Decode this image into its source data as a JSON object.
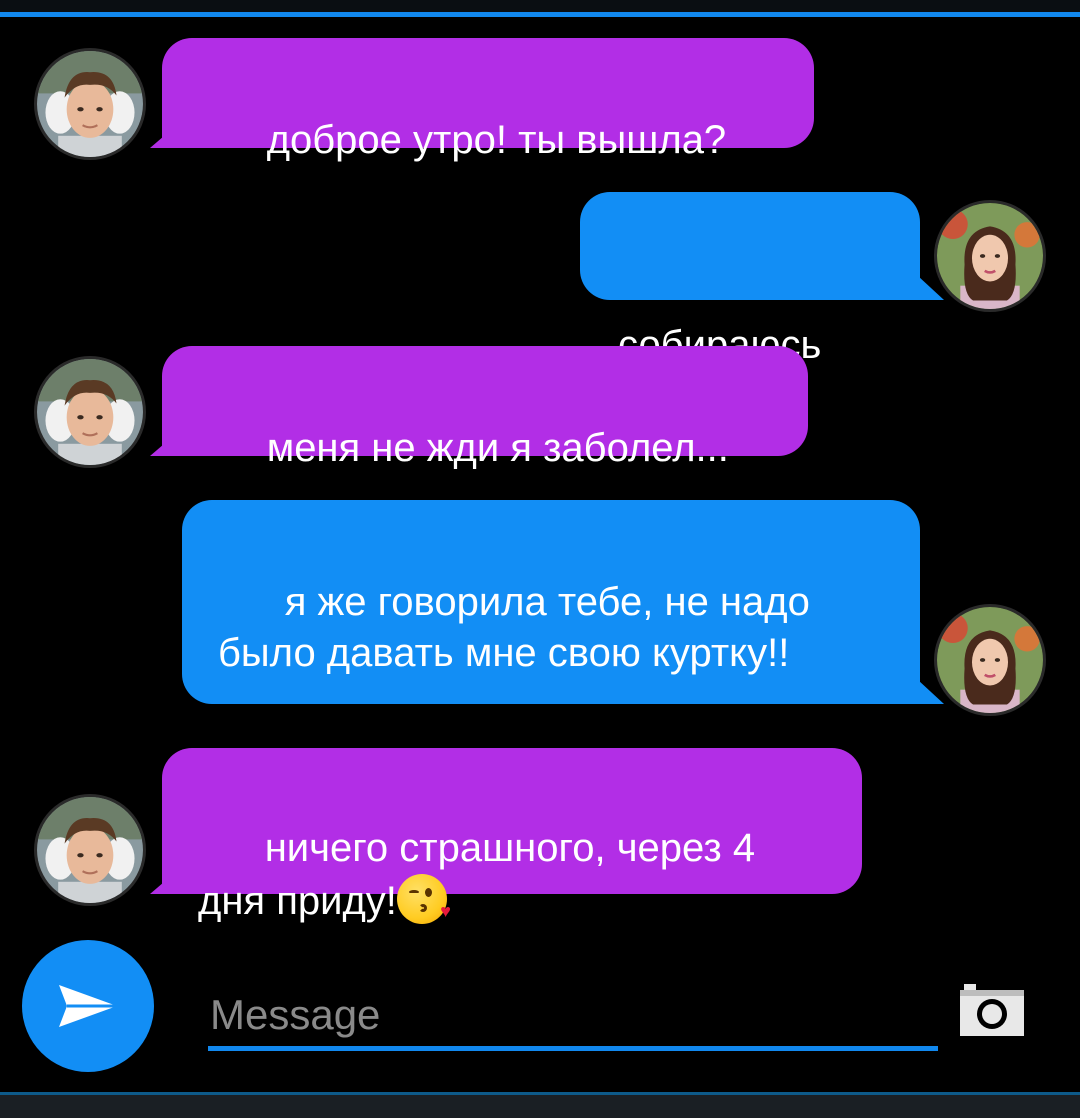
{
  "colors": {
    "accent": "#1188ee",
    "incoming_bubble": "#b22ee6",
    "outgoing_bubble": "#128ef5"
  },
  "messages": [
    {
      "direction": "incoming",
      "avatar": "boy-avatar",
      "text": "доброе утро! ты вышла?"
    },
    {
      "direction": "outgoing",
      "avatar": "girl-avatar",
      "text": "собираюсь"
    },
    {
      "direction": "incoming",
      "avatar": "boy-avatar",
      "text": "меня не жди я заболел..."
    },
    {
      "direction": "outgoing",
      "avatar": "girl-avatar",
      "text": "я же говорила тебе, не надо было давать мне свою куртку!!"
    },
    {
      "direction": "incoming",
      "avatar": "boy-avatar",
      "text": "ничего страшного, через 4 дня приду!",
      "emoji": "kissing-face-with-heart"
    }
  ],
  "composer": {
    "placeholder": "Message",
    "value": "",
    "send_icon": "send-arrow-icon",
    "camera_icon": "camera-icon"
  }
}
